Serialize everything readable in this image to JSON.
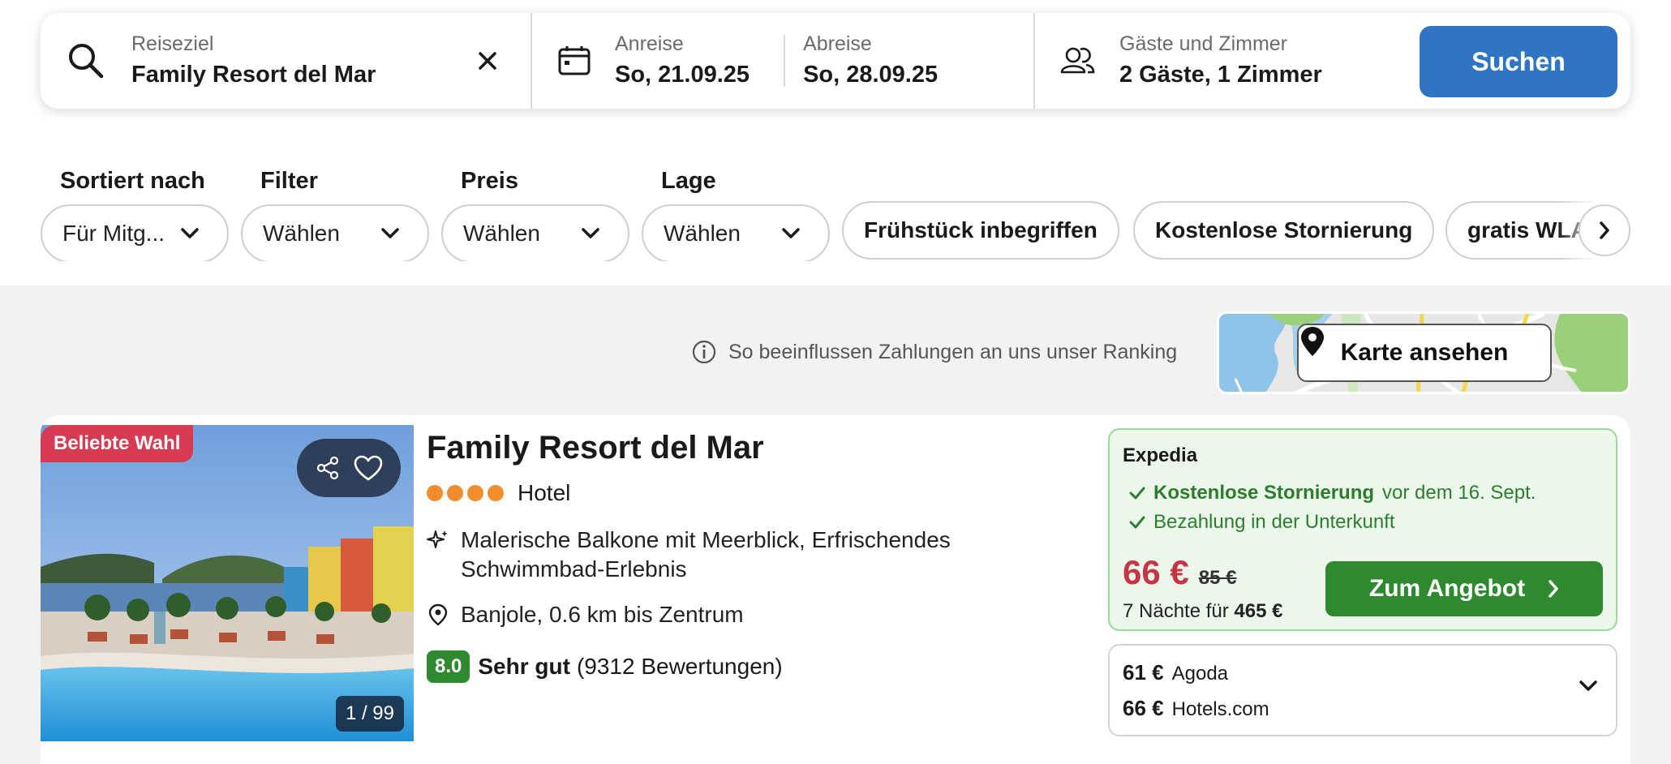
{
  "search": {
    "destination_label": "Reiseziel",
    "destination_value": "Family Resort del Mar",
    "checkin_label": "Anreise",
    "checkin_value": "So, 21.09.25",
    "checkout_label": "Abreise",
    "checkout_value": "So, 28.09.25",
    "guests_label": "Gäste und Zimmer",
    "guests_value": "2 Gäste, 1 Zimmer",
    "button_label": "Suchen"
  },
  "filters": {
    "dropdowns": [
      {
        "label": "Sortiert nach",
        "value": "Für Mitg..."
      },
      {
        "label": "Filter",
        "value": "Wählen"
      },
      {
        "label": "Preis",
        "value": "Wählen"
      },
      {
        "label": "Lage",
        "value": "Wählen"
      }
    ],
    "chips": [
      "Frühstück inbegriffen",
      "Kostenlose Stornierung",
      "gratis WLAN"
    ]
  },
  "ranking_note": "So beeinflussen Zahlungen an uns unser Ranking",
  "map_button": "Karte ansehen",
  "hotel": {
    "badge": "Beliebte Wahl",
    "photo_count": "1 / 99",
    "name": "Family Resort del Mar",
    "stars": 4,
    "type": "Hotel",
    "features_line1": "Malerische Balkone mit Meerblick, Erfrischendes",
    "features_line2": "Schwimmbad-Erlebnis",
    "location": "Banjole, 0.6 km bis Zentrum",
    "score": "8.0",
    "rating_word": "Sehr gut",
    "reviews": "(9312 Bewertungen)"
  },
  "deal": {
    "provider": "Expedia",
    "perk1_bold": "Kostenlose Stornierung",
    "perk1_rest": "vor dem 16. Sept.",
    "perk2": "Bezahlung in der Unterkunft",
    "price": "66 €",
    "old_price": "85 €",
    "total_prefix": "7 Nächte für",
    "total_amount": "465 €",
    "button_label": "Zum Angebot"
  },
  "other_offers": [
    {
      "price": "61 €",
      "provider": "Agoda"
    },
    {
      "price": "66 €",
      "provider": "Hotels.com"
    }
  ],
  "colors": {
    "primary_blue": "#2f75c2",
    "deal_green": "#2f8a2f",
    "price_red": "#c53545",
    "badge_red": "#d73b52",
    "star_orange": "#f08c2c"
  }
}
